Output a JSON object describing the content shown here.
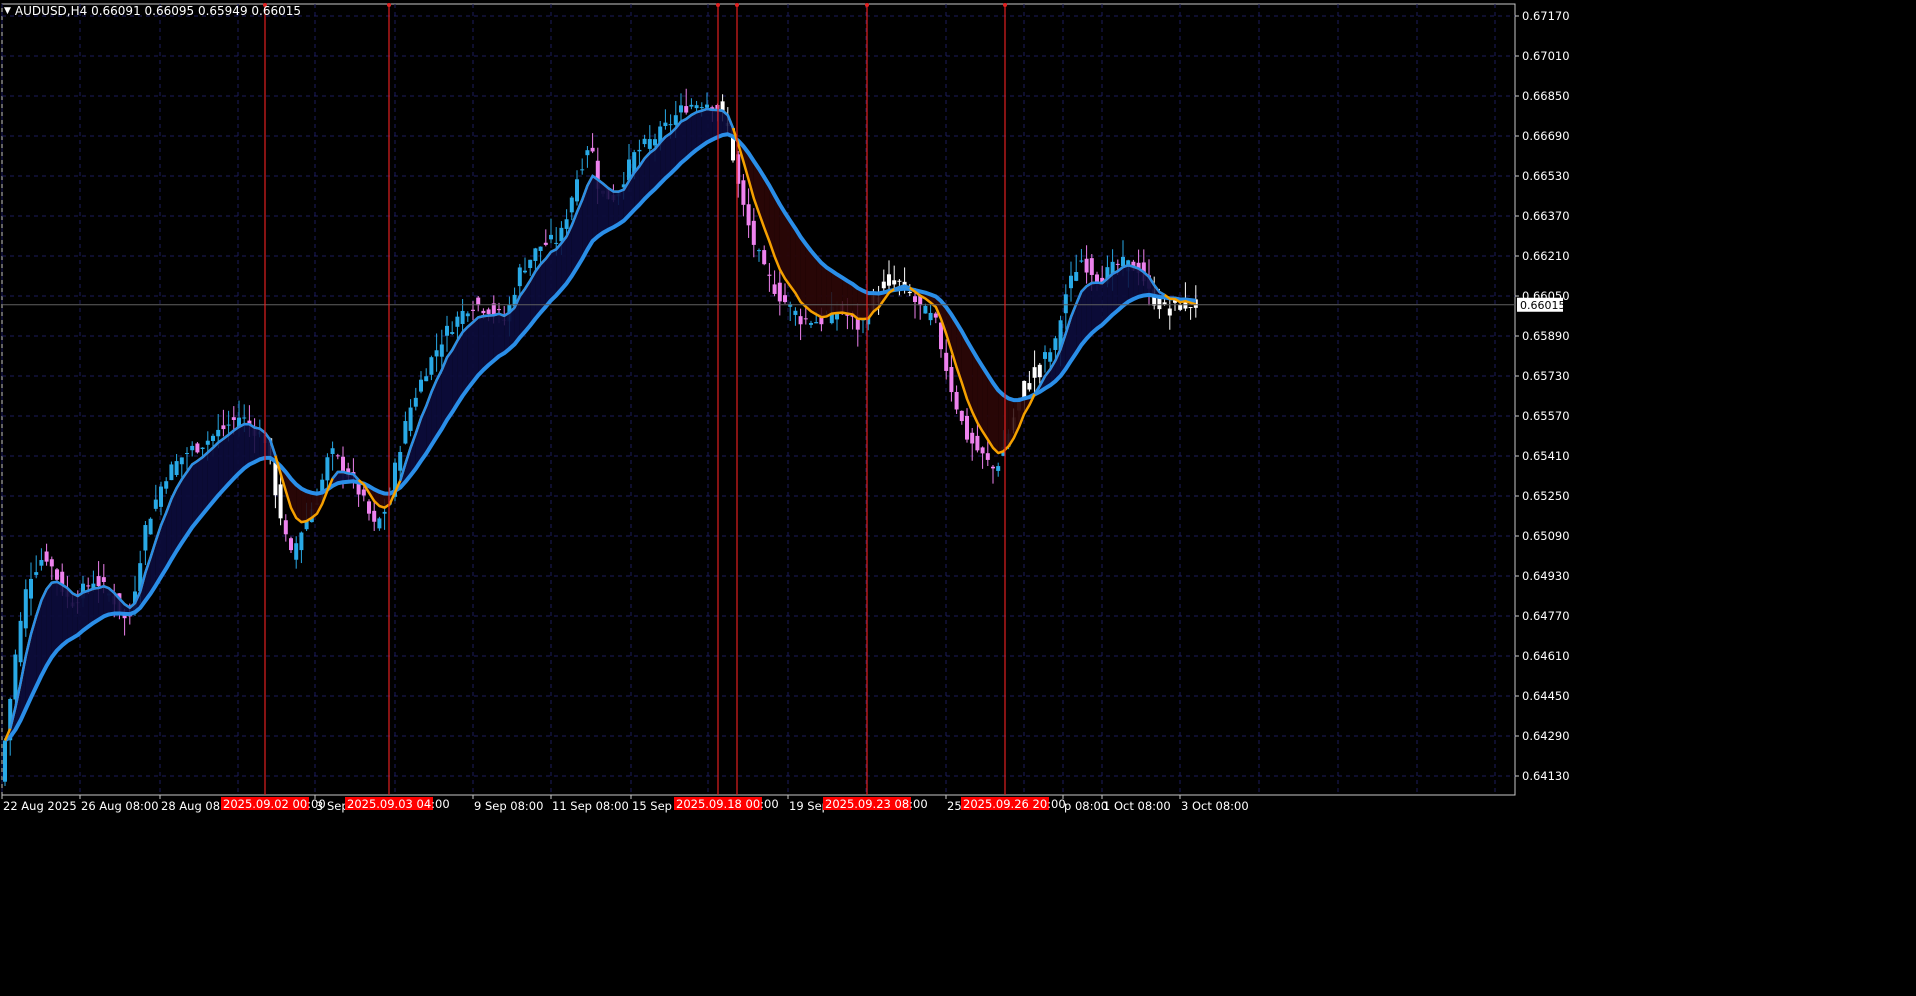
{
  "window": {
    "symbol_line": "AUDUSD,H4  0.66091 0.66095 0.65949 0.66015",
    "triangle": "▼"
  },
  "price_axis": {
    "labels": [
      "0.67170",
      "0.67010",
      "0.66850",
      "0.66690",
      "0.66530",
      "0.66370",
      "0.66210",
      "0.66050",
      "0.65890",
      "0.65730",
      "0.65570",
      "0.65410",
      "0.65250",
      "0.65090",
      "0.64930",
      "0.64770",
      "0.64610",
      "0.64450",
      "0.64290",
      "0.64130"
    ],
    "current_price": "0.66015",
    "current_price_color": "#ffffff"
  },
  "time_axis": {
    "labels": [
      "22 Aug 2025",
      "26 Aug 08:00",
      "28 Aug 08:00",
      "3 Sep",
      "9 Sep 08:00",
      "11 Sep 08:00",
      "15 Sep 0",
      "19 Sep",
      "25",
      "p 08:00",
      "1 Oct 08:00",
      "3 Oct 08:00"
    ]
  },
  "markers": [
    {
      "tag": "2025.09.02 00:00"
    },
    {
      "tag": "2025.09.03 04:00"
    },
    {
      "tag": "2025.09.18 00:00"
    },
    {
      "tag": "2025.09.23 08:00"
    },
    {
      "tag": "2025.09.26 20:00"
    }
  ],
  "colors": {
    "background": "#000000",
    "grid": "#1c1c5c",
    "bull_candle": "#29a9e6",
    "bear_candle": "#ee82ee",
    "neutral_candle": "#ffffff",
    "fast_ma": "#f5a000",
    "slow_ma": "#2a8ee8",
    "fill_up": "#0c0c3a",
    "fill_down": "#2a0606",
    "marker_line": "#e02020",
    "marker_tag": "#ff0000"
  },
  "chart_data": {
    "type": "candlestick",
    "symbol": "AUDUSD",
    "timeframe": "H4",
    "ylim": [
      0.6413,
      0.6725
    ],
    "last": {
      "open": 0.66091,
      "high": 0.66095,
      "low": 0.65949,
      "close": 0.66015
    },
    "key_points": [
      {
        "t": "22 Aug 2025",
        "price": 0.6424
      },
      {
        "t": "26 Aug 08:00",
        "price": 0.6482
      },
      {
        "t": "28 Aug 08:00",
        "price": 0.6552
      },
      {
        "t": "3 Sep",
        "price": 0.6522
      },
      {
        "t": "9 Sep 08:00",
        "price": 0.6603
      },
      {
        "t": "11 Sep 08:00",
        "price": 0.6669
      },
      {
        "t": "15 Sep",
        "price": 0.6686
      },
      {
        "t": "19 Sep",
        "price": 0.6595
      },
      {
        "t": "25",
        "price": 0.6528
      },
      {
        "t": "1 Oct 08:00",
        "price": 0.6617
      },
      {
        "t": "3 Oct 08:00",
        "price": 0.66015
      }
    ],
    "fast_ma_name": "",
    "slow_ma_name": ""
  }
}
